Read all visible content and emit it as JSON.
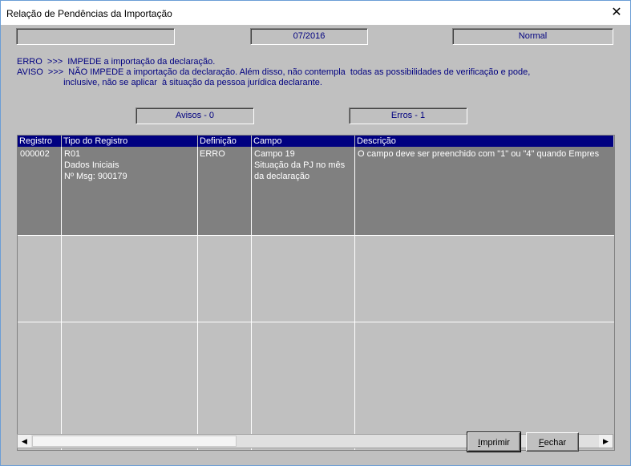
{
  "window": {
    "title": "Relação de Pendências da Importação",
    "close_symbol": "✕"
  },
  "top_fields": {
    "field1": "",
    "period": "07/2016",
    "mode": "Normal"
  },
  "info": {
    "line1": "ERRO  >>>  IMPEDE a importação da declaração.",
    "line2": "AVISO  >>>  NÃO IMPEDE a importação da declaração. Além disso, não contempla  todas as possibilidades de verificação e pode,",
    "line3": "                   inclusive, não se aplicar  à situação da pessoa jurídica declarante."
  },
  "counters": {
    "avisos": "Avisos - 0",
    "erros": "Erros - 1"
  },
  "table": {
    "headers": [
      "Registro",
      "Tipo do Registro",
      "Definição",
      "Campo",
      "Descrição"
    ],
    "rows": [
      {
        "registro": "000002",
        "tipo": [
          "R01",
          "Dados Iniciais",
          "Nº Msg: 900179"
        ],
        "definicao": "ERRO",
        "campo": [
          "Campo 19",
          "Situação da PJ no mês",
          "da declaração"
        ],
        "descricao": "O campo deve ser preenchido com \"1\" ou \"4\" quando Empres"
      }
    ]
  },
  "scrollbar": {
    "left_arrow": "◀",
    "right_arrow": "▶"
  },
  "buttons": {
    "print_hotkey": "I",
    "print_rest": "mprimir",
    "close_hotkey": "F",
    "close_rest": "echar"
  },
  "colors": {
    "accent": "#000080",
    "face": "#c0c0c0",
    "selected_row": "#808080"
  }
}
